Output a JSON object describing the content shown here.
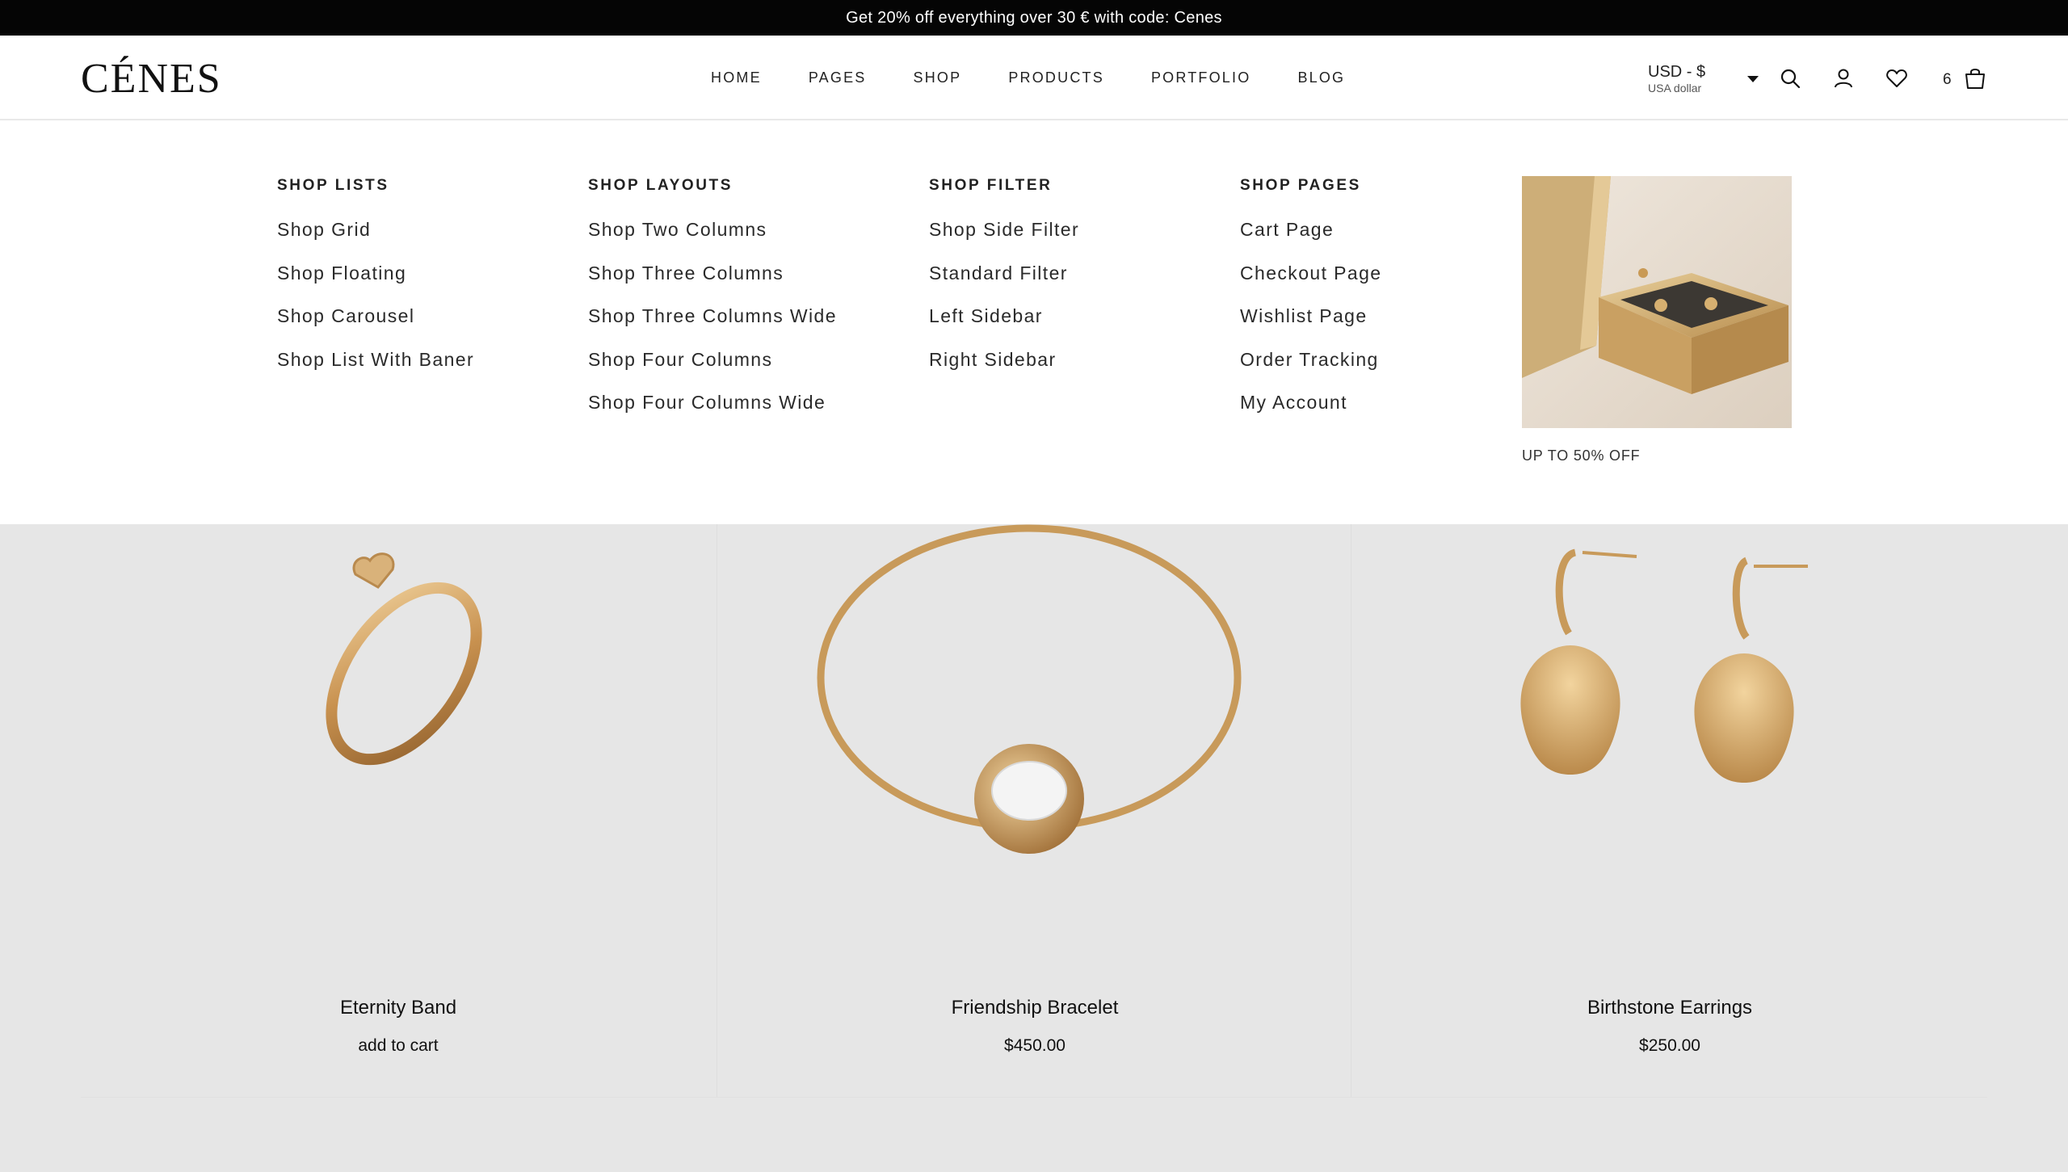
{
  "announcement": "Get 20% off everything over 30 € with code: Cenes",
  "header": {
    "logo": "CÉNES",
    "nav": [
      "HOME",
      "PAGES",
      "SHOP",
      "PRODUCTS",
      "PORTFOLIO",
      "BLOG"
    ],
    "currency": {
      "code": "USD - $",
      "name": "USA dollar"
    },
    "cart_count": "6",
    "icons": [
      "search-icon",
      "user-icon",
      "heart-icon",
      "shopping-bag-icon"
    ]
  },
  "mega_menu": {
    "columns": [
      {
        "title": "SHOP LISTS",
        "links": [
          "Shop Grid",
          "Shop Floating",
          "Shop Carousel",
          "Shop List With Baner"
        ]
      },
      {
        "title": "SHOP LAYOUTS",
        "links": [
          "Shop Two Columns",
          "Shop Three Columns",
          "Shop Three Columns Wide",
          "Shop Four Columns",
          "Shop Four Columns Wide"
        ]
      },
      {
        "title": "SHOP FILTER",
        "links": [
          "Shop Side Filter",
          "Standard Filter",
          "Left Sidebar",
          "Right Sidebar"
        ]
      },
      {
        "title": "SHOP PAGES",
        "links": [
          "Cart Page",
          "Checkout Page",
          "Wishlist Page",
          "Order Tracking",
          "My Account"
        ]
      }
    ],
    "promo": {
      "label": "UP TO 50% OFF"
    }
  },
  "products": [
    {
      "name": "Eternity Band",
      "price": "add to cart"
    },
    {
      "name": "Friendship Bracelet",
      "price": "$450.00"
    },
    {
      "name": "Birthstone Earrings",
      "price": "$250.00"
    }
  ],
  "colors": {
    "topbar": "#050505",
    "gold": "#c89a5a",
    "page_bg": "#e6e6e6"
  }
}
